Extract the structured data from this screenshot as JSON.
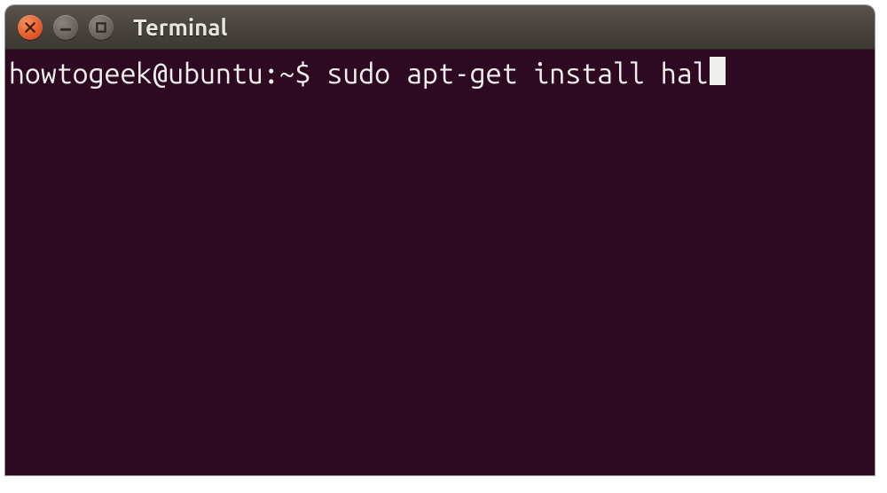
{
  "window": {
    "title": "Terminal"
  },
  "terminal": {
    "prompt": "howtogeek@ubuntu:~$ ",
    "command": "sudo apt-get install hal"
  }
}
